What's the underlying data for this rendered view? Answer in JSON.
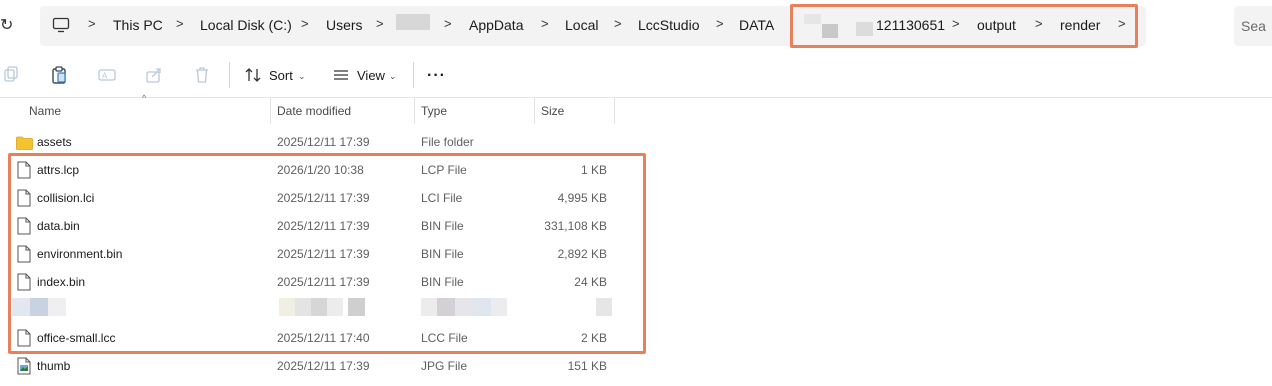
{
  "address": {
    "refresh_glyph": "↻",
    "crumbs": [
      "This PC",
      "Local Disk (C:)",
      "Users",
      "AppData",
      "Local",
      "LccStudio",
      "DATA",
      "121130651",
      "output",
      "render"
    ],
    "search_placeholder": "Sea"
  },
  "toolbar": {
    "sort_label": "Sort",
    "view_label": "View",
    "more_label": "···"
  },
  "columns": {
    "name": "Name",
    "date": "Date modified",
    "type": "Type",
    "size": "Size"
  },
  "rows": [
    {
      "name": "assets",
      "date": "2025/12/11 17:39",
      "type": "File folder",
      "size": "",
      "icon": "folder-icon"
    },
    {
      "name": "attrs.lcp",
      "date": "2026/1/20 10:38",
      "type": "LCP File",
      "size": "1 KB",
      "icon": "file-icon"
    },
    {
      "name": "collision.lci",
      "date": "2025/12/11 17:39",
      "type": "LCI File",
      "size": "4,995 KB",
      "icon": "file-icon"
    },
    {
      "name": "data.bin",
      "date": "2025/12/11 17:39",
      "type": "BIN File",
      "size": "331,108 KB",
      "icon": "file-icon"
    },
    {
      "name": "environment.bin",
      "date": "2025/12/11 17:39",
      "type": "BIN File",
      "size": "2,892 KB",
      "icon": "file-icon"
    },
    {
      "name": "index.bin",
      "date": "2025/12/11 17:39",
      "type": "BIN File",
      "size": "24 KB",
      "icon": "file-icon"
    },
    {
      "name": "",
      "date": "",
      "type": "",
      "size": "",
      "icon": "redacted"
    },
    {
      "name": "office-small.lcc",
      "date": "2025/12/11 17:40",
      "type": "LCC File",
      "size": "2 KB",
      "icon": "file-icon"
    },
    {
      "name": "thumb",
      "date": "2025/12/11 17:39",
      "type": "JPG File",
      "size": "151 KB",
      "icon": "image-file-icon"
    }
  ],
  "colors": {
    "highlight": "#e8805c",
    "folder": "#f4c430"
  }
}
